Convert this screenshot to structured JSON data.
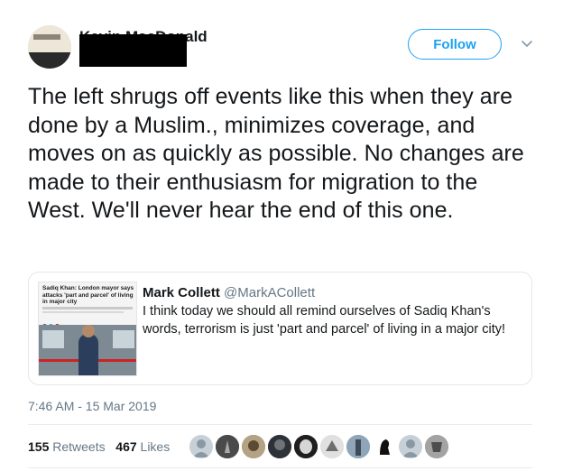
{
  "author": {
    "display_name": "Kevin MacDonald"
  },
  "follow_button": {
    "label": "Follow"
  },
  "tweet": {
    "text": "The left shrugs off events like this when they are done by a Muslim., minimizes coverage, and moves on as quickly as possible. No changes are made to their enthusiasm for migration to the West. We'll never hear the end of this one.",
    "timestamp": "7:46 AM - 15 Mar 2019"
  },
  "quoted_tweet": {
    "name": "Mark Collett",
    "handle": "@MarkACollett",
    "text": "I think today we should all remind ourselves of Sadiq Khan's words, terrorism is just 'part and parcel' of living in a major city!",
    "thumbnail_headline": "Sadiq Khan: London mayor says attacks 'part and parcel' of living in major city"
  },
  "stats": {
    "retweets_count": "155",
    "retweets_label": "Retweets",
    "likes_count": "467",
    "likes_label": "Likes"
  },
  "icons": {
    "caret": "chevron-down-icon"
  },
  "colors": {
    "accent": "#1da1f2",
    "secondary_text": "#657786",
    "primary_text": "#14171a"
  }
}
